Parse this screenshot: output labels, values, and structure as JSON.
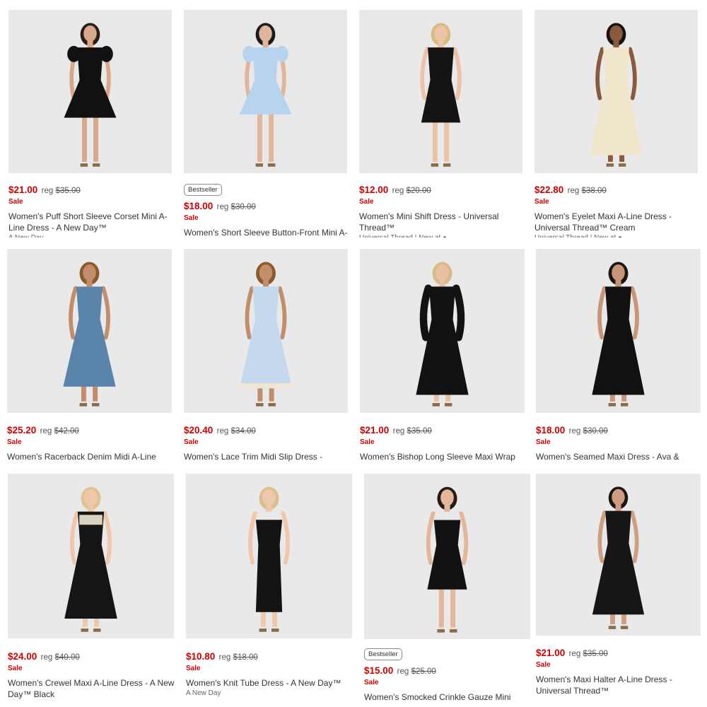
{
  "products": [
    {
      "price": "$21.00",
      "reg": "reg",
      "was": "$35.00",
      "sale": "Sale",
      "badge": "",
      "title": "Women's Puff Short Sleeve Corset Mini A-Line Dress - A New Day™",
      "brand": "A New Day",
      "dress_color": "#111111",
      "bg": "#e9e9e9",
      "skin": "#d9a88a",
      "hair": "#2a1e18",
      "style": "puff"
    },
    {
      "price": "$18.00",
      "reg": "reg",
      "was": "$30.00",
      "sale": "Sale",
      "badge": "Bestseller",
      "title": "Women's Short Sleeve Button-Front Mini A-",
      "brand": "",
      "dress_color": "#b8d3ee",
      "bg": "#e8e8e8",
      "skin": "#e0b59a",
      "hair": "#1d1a1a",
      "style": "mini"
    },
    {
      "price": "$12.00",
      "reg": "reg",
      "was": "$20.00",
      "sale": "Sale",
      "badge": "",
      "title": "Women's Mini Shift Dress - Universal Thread™",
      "brand": "Universal Thread | New at ●",
      "dress_color": "#141414",
      "bg": "#e9e9e9",
      "skin": "#ecc3a6",
      "hair": "#d7bd7d",
      "style": "shift"
    },
    {
      "price": "$22.80",
      "reg": "reg",
      "was": "$38.00",
      "sale": "Sale",
      "badge": "",
      "title": "Women's Eyelet Maxi A-Line Dress - Universal Thread™ Cream",
      "brand": "Universal Thread | New at ●",
      "dress_color": "#f0e6cc",
      "bg": "#e9e9e9",
      "skin": "#8a5a3e",
      "hair": "#1a1210",
      "style": "maxi"
    },
    {
      "price": "$25.20",
      "reg": "reg",
      "was": "$42.00",
      "sale": "Sale",
      "badge": "",
      "title": "Women's Racerback Denim Midi A-Line",
      "brand": "",
      "dress_color": "#5b84ab",
      "bg": "#e9e9e9",
      "skin": "#c28e6a",
      "hair": "#8a5a2c",
      "style": "midi"
    },
    {
      "price": "$20.40",
      "reg": "reg",
      "was": "$34.00",
      "sale": "Sale",
      "badge": "",
      "title": "Women's Lace Trim Midi Slip Dress - Future",
      "brand": "",
      "dress_color": "#c4d8ee",
      "bg": "#e9e9e9",
      "skin": "#c28e6a",
      "hair": "#8a5a2c",
      "style": "slip"
    },
    {
      "price": "$21.00",
      "reg": "reg",
      "was": "$35.00",
      "sale": "Sale",
      "badge": "",
      "title": "Women's Bishop Long Sleeve Maxi Wrap",
      "brand": "",
      "dress_color": "#121212",
      "bg": "#e9e9e9",
      "skin": "#ebc0a2",
      "hair": "#d7bb86",
      "style": "bishop"
    },
    {
      "price": "$18.00",
      "reg": "reg",
      "was": "$30.00",
      "sale": "Sale",
      "badge": "",
      "title": "Women's Seamed Maxi Dress - Ava & Viv™",
      "brand": "",
      "dress_color": "#111111",
      "bg": "#e9e9e9",
      "skin": "#c99577",
      "hair": "#1c1512",
      "style": "maxi"
    },
    {
      "price": "$24.00",
      "reg": "reg",
      "was": "$40.00",
      "sale": "Sale",
      "badge": "",
      "title": "Women's Crewel Maxi A-Line Dress - A New Day™ Black",
      "brand": "",
      "dress_color": "#151515",
      "bg": "#e9e9e9",
      "skin": "#efc7ab",
      "hair": "#e0c48e",
      "style": "crewel"
    },
    {
      "price": "$10.80",
      "reg": "reg",
      "was": "$18.00",
      "sale": "Sale",
      "badge": "",
      "title": "Women's Knit Tube Dress - A New Day™",
      "brand": "A New Day",
      "dress_color": "#131313",
      "bg": "#e9e9e9",
      "skin": "#efc7ab",
      "hair": "#dcc08c",
      "style": "tube"
    },
    {
      "price": "$15.00",
      "reg": "reg",
      "was": "$25.00",
      "sale": "Sale",
      "badge": "Bestseller",
      "title": "Women's Smocked Crinkle Gauze Mini",
      "brand": "",
      "dress_color": "#121212",
      "bg": "#e9e9e9",
      "skin": "#e4b69a",
      "hair": "#241a16",
      "style": "strapless"
    },
    {
      "price": "$21.00",
      "reg": "reg",
      "was": "$35.00",
      "sale": "Sale",
      "badge": "",
      "title": "Women's Maxi Halter A-Line Dress - Universal Thread™",
      "brand": "",
      "dress_color": "#161616",
      "bg": "#e9e9e9",
      "skin": "#cf9e80",
      "hair": "#1c1512",
      "style": "halter"
    }
  ]
}
